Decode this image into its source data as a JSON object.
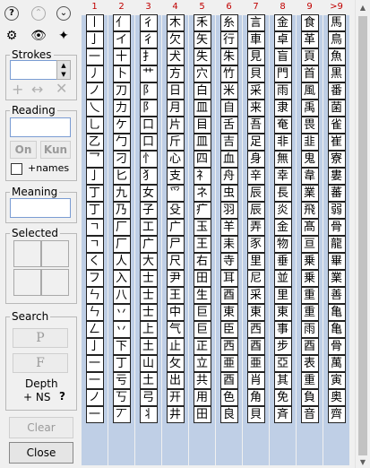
{
  "toolbar": {
    "help_icon": "?",
    "up_icon": "chevron-up",
    "down_icon": "chevron-down"
  },
  "strokes": {
    "legend": "Strokes",
    "value": ""
  },
  "reading": {
    "legend": "Reading",
    "value": "",
    "on_label": "On",
    "kun_label": "Kun",
    "names_label": "+names"
  },
  "meaning": {
    "legend": "Meaning",
    "value": ""
  },
  "selected": {
    "legend": "Selected"
  },
  "search": {
    "legend": "Search",
    "p_label": "P",
    "f_label": "F",
    "depth_label": "Depth",
    "ns_label": "+ NS",
    "help": "?"
  },
  "clear_label": "Clear",
  "close_label": "Close",
  "columns": [
    "1",
    "2",
    "3",
    "4",
    "5",
    "6",
    "7",
    "8",
    "9",
    ">9"
  ],
  "grid": [
    [
      "丨",
      "亻",
      "彳",
      "木",
      "禾",
      "糸",
      "言",
      "金",
      "食",
      "馬"
    ],
    [
      "亅",
      "イ",
      "彳",
      "欠",
      "矢",
      "行",
      "車",
      "卓",
      "革",
      "鳥"
    ],
    [
      "一",
      "十",
      "扌",
      "犬",
      "失",
      "朱",
      "見",
      "盲",
      "頁",
      "魚"
    ],
    [
      "丿",
      "卜",
      "艹",
      "方",
      "穴",
      "竹",
      "貝",
      "門",
      "首",
      "黒"
    ],
    [
      "ノ",
      "刀",
      "阝",
      "日",
      "白",
      "米",
      "采",
      "雨",
      "風",
      "番"
    ],
    [
      "乀",
      "力",
      "阝",
      "月",
      "皿",
      "自",
      "来",
      "隶",
      "禹",
      "菌"
    ],
    [
      "乚",
      "ケ",
      "口",
      "片",
      "目",
      "舌",
      "吾",
      "奄",
      "畏",
      "雀"
    ],
    [
      "乙",
      "勹",
      "口",
      "斤",
      "皿",
      "吉",
      "足",
      "非",
      "韭",
      "崔"
    ],
    [
      "乛",
      "刁",
      "忄",
      "心",
      "四",
      "血",
      "身",
      "無",
      "鬼",
      "寮"
    ],
    [
      "亅",
      "匕",
      "犭",
      "支",
      "礻",
      "舟",
      "辛",
      "幸",
      "韋",
      "婁"
    ],
    [
      "丁",
      "九",
      "女",
      "爫",
      "ネ",
      "虫",
      "辰",
      "長",
      "業",
      "蕃"
    ],
    [
      "丁",
      "乃",
      "子",
      "殳",
      "疒",
      "羽",
      "辰",
      "炎",
      "飛",
      "弱"
    ],
    [
      "ㄱ",
      "厂",
      "工",
      "广",
      "玉",
      "羊",
      "弄",
      "金",
      "髙",
      "骨"
    ],
    [
      "ㄱ",
      "厂",
      "广",
      "尸",
      "王",
      "耒",
      "豕",
      "物",
      "亘",
      "龍"
    ],
    [
      "く",
      "人",
      "大",
      "尺",
      "右",
      "寺",
      "里",
      "垂",
      "乗",
      "畢"
    ],
    [
      "フ",
      "入",
      "士",
      "尹",
      "田",
      "耳",
      "尼",
      "並",
      "乗",
      "業"
    ],
    [
      "ㄣ",
      "八",
      "士",
      "王",
      "生",
      "酉",
      "采",
      "里",
      "重",
      "善"
    ],
    [
      "ㄣ",
      "丷",
      "士",
      "中",
      "巨",
      "東",
      "東",
      "東",
      "重",
      "亀"
    ],
    [
      "ㄥ",
      "丷",
      "上",
      "气",
      "巨",
      "臣",
      "西",
      "事",
      "雨",
      "亀"
    ],
    [
      "亅",
      "下",
      "土",
      "止",
      "正",
      "西",
      "酉",
      "步",
      "酉",
      "骨"
    ],
    [
      "一",
      "丁",
      "山",
      "攵",
      "立",
      "亜",
      "亜",
      "亞",
      "表",
      "萬"
    ],
    [
      "一",
      "亏",
      "土",
      "出",
      "共",
      "酉",
      "肖",
      "其",
      "重",
      "寅"
    ],
    [
      "ノ",
      "丂",
      "弓",
      "开",
      "用",
      "色",
      "角",
      "免",
      "負",
      "奥"
    ],
    [
      "一",
      "丆",
      "丬",
      "井",
      "田",
      "良",
      "貝",
      "斉",
      "音",
      "齊"
    ]
  ]
}
